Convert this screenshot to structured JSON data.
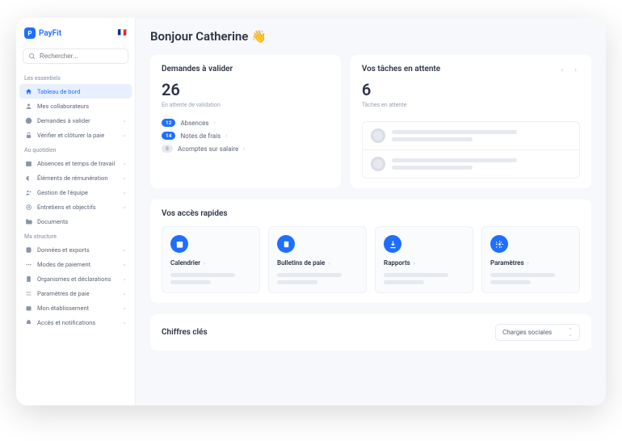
{
  "brand": {
    "name": "PayFit",
    "flag": "🇫🇷"
  },
  "search": {
    "placeholder": "Rechercher..."
  },
  "sections": {
    "essentials": "Les essentiels",
    "daily": "Au quotidien",
    "structure": "Ma structure"
  },
  "nav": {
    "dashboard": "Tableau de bord",
    "collaborators": "Mes collaborateurs",
    "requests": "Demandes à valider",
    "verify": "Vérifier et clôturer la paie",
    "absences": "Absences et temps de travail",
    "remuneration": "Éléments de rémunération",
    "team": "Gestion de l'équipe",
    "interviews": "Entretiens et objectifs",
    "documents": "Documents",
    "data": "Données et exports",
    "payment": "Modes de paiement",
    "orgs": "Organismes et déclarations",
    "payparams": "Paramètres de paie",
    "establishment": "Mon établissement",
    "access": "Accès et notifications"
  },
  "greeting": "Bonjour Catherine 👋",
  "requests_card": {
    "title": "Demandes à valider",
    "count": "26",
    "sub": "En attente de validation",
    "items": [
      {
        "badge": "12",
        "label": "Absences",
        "grey": false
      },
      {
        "badge": "14",
        "label": "Notes de frais",
        "grey": false
      },
      {
        "badge": "0",
        "label": "Acomptes sur salaire",
        "grey": true
      }
    ]
  },
  "tasks_card": {
    "title": "Vos tâches en attente",
    "count": "6",
    "sub": "Tâches en attente"
  },
  "quick": {
    "title": "Vos accès rapides",
    "items": {
      "calendar": "Calendrier",
      "payslips": "Bulletins de paie",
      "reports": "Rapports",
      "settings": "Paramètres"
    }
  },
  "kpi": {
    "title": "Chiffres clés",
    "select": "Charges sociales"
  }
}
